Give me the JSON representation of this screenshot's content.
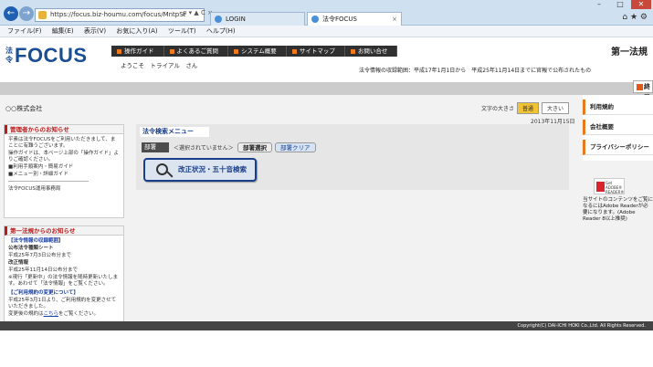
{
  "browser": {
    "address": "https://focus.biz-houmu.com/focus/MntpSt",
    "address_controls": "ρ ▾ ▲ C ×",
    "tabs": [
      {
        "label": "LOGIN"
      },
      {
        "label": "法令FOCUS"
      }
    ],
    "window_buttons": {
      "min": "–",
      "max": "□",
      "close": "✕"
    },
    "right_icons": "⌂ ★ ⚙",
    "menu": [
      "ファイル(F)",
      "編集(E)",
      "表示(V)",
      "お気に入り(A)",
      "ツール(T)",
      "ヘルプ(H)"
    ]
  },
  "header": {
    "logo_prefix": "法令",
    "logo_main": "FOCUS",
    "nav": [
      "操作ガイド",
      "よくあるご質問",
      "システム概要",
      "サイトマップ",
      "お問い合せ"
    ],
    "welcome": "ようこそ　トライアル　さん",
    "company": "第一法規",
    "period": "法令情報の収録範囲：平成17年1月1日から　平成25年11月14日までに官報で公布されたもの",
    "end_button": "終了"
  },
  "main": {
    "company_name": "○○株式会社",
    "font_size_label": "文字の大きさ",
    "font_normal": "普通",
    "font_large": "大きい",
    "date": "2013年11月15日"
  },
  "admin_notice": {
    "title": "管理者からのお知らせ",
    "lines": [
      "平素は法令FOCUSをご利用いただきまして、まことに有難うございます。",
      "操作ガイドは、本ページ上部の「操作ガイド」よりご確認ください。",
      "■利用手順案内・簡易ガイド",
      "■メニュー別・詳細ガイド",
      "――――――――――――――――",
      "法令FOCUS運用事務局"
    ]
  },
  "company_notice": {
    "title": "第一法規からのお知らせ",
    "item1_title": "【法令情報の収録範囲】",
    "item1_sub": "公布法令種類シート",
    "item1_line1": "平成25年7月3日公布分まで",
    "item1_sub2": "改正情報",
    "item1_line2": "平成25年11月14日公布分まで",
    "item1_line3": "※現行「更新中」の法令情報を随時更新いたします。あわせて「法令情報」をご覧ください。",
    "item2_title": "【ご利用規約の変更について】",
    "item2_line1": "平成25年3月1日より、ご利用規約を変更させていただきました。",
    "item2_line2a": "変更後の規約は",
    "item2_link": "こちら",
    "item2_line2b": "をご覧ください。"
  },
  "search": {
    "title": "法令検索メニュー",
    "dept_label": "部署",
    "dept_value": "＜選択されていません＞",
    "dept_select": "部署選択",
    "dept_clear": "部署クリア",
    "big_button": "改正状況・五十音検索"
  },
  "right_nav": {
    "items": [
      "利用規約",
      "会社概要",
      "プライバシーポリシー"
    ],
    "adobe_badge": "Get ADOBE® READER®",
    "adobe_text": "当サイトのコンテンツをご覧になるにはAdobe Readerが必要になります。(Adobe Reader 8以上推奨)"
  },
  "footer": {
    "copyright": "Copyright(C) DAI-ICHI HOKI Co.,Ltd. All Rights Reserved."
  }
}
